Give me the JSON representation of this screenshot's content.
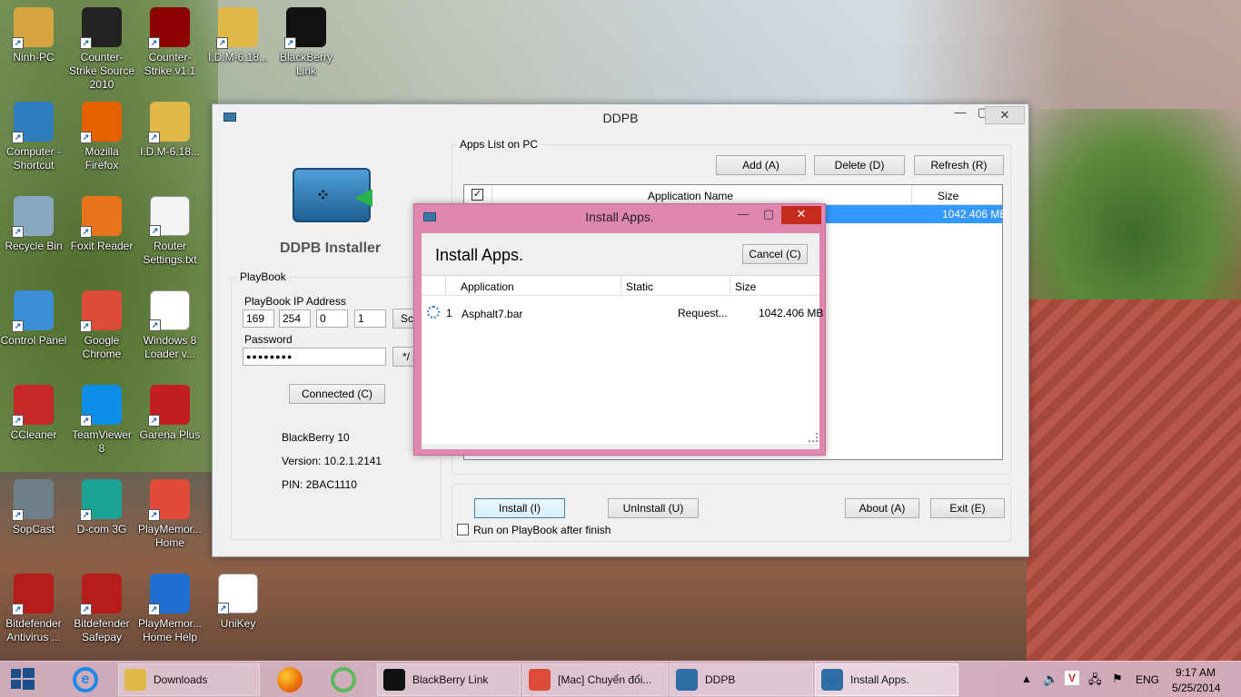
{
  "desktop_icons": [
    {
      "label": "Ninh-PC",
      "icon": "user-folder-icon",
      "color": "#d7a642"
    },
    {
      "label": "Counter-Strike Source 2010",
      "icon": "counter-strike-icon",
      "color": "#222222"
    },
    {
      "label": "Counter-Strike v1.1",
      "icon": "counter-strike-cs-icon",
      "color": "#8b0000"
    },
    {
      "label": "I.D.M-6.18...",
      "icon": "zip-folder-icon",
      "color": "#e2b84a"
    },
    {
      "label": "BlackBerry Link",
      "icon": "blackberry-icon",
      "color": "#111111"
    },
    {
      "label": "Computer - Shortcut",
      "icon": "computer-icon",
      "color": "#2f7cc2"
    },
    {
      "label": "Mozilla Firefox",
      "icon": "firefox-icon",
      "color": "#e66000"
    },
    {
      "label": "I.D.M-6.18...",
      "icon": "zip-folder-icon",
      "color": "#e2b84a"
    },
    {
      "label": "Recycle Bin",
      "icon": "recycle-bin-icon",
      "color": "#8aa7c0"
    },
    {
      "label": "Foxit Reader",
      "icon": "foxit-pdf-icon",
      "color": "#e8741e"
    },
    {
      "label": "Router Settings.txt",
      "icon": "text-file-icon",
      "color": "#f4f4f4"
    },
    {
      "label": "Control Panel",
      "icon": "control-panel-icon",
      "color": "#3b8fd6"
    },
    {
      "label": "Google Chrome",
      "icon": "chrome-icon",
      "color": "#dd4b39"
    },
    {
      "label": "Windows 8 Loader v...",
      "icon": "file-icon",
      "color": "#ffffff"
    },
    {
      "label": "CCleaner",
      "icon": "ccleaner-icon",
      "color": "#c62828"
    },
    {
      "label": "TeamViewer 8",
      "icon": "teamviewer-icon",
      "color": "#0e8ee9"
    },
    {
      "label": "Garena Plus",
      "icon": "garena-icon",
      "color": "#c21f1f"
    },
    {
      "label": "SopCast",
      "icon": "sopcast-icon",
      "color": "#6f7f8a"
    },
    {
      "label": "D-com 3G",
      "icon": "viettel-icon",
      "color": "#1aa392"
    },
    {
      "label": "PlayMemor... Home",
      "icon": "playmemories-icon",
      "color": "#e24a3a"
    },
    {
      "label": "Bitdefender Antivirus ...",
      "icon": "bitdefender-icon",
      "color": "#b71c1c"
    },
    {
      "label": "Bitdefender Safepay",
      "icon": "bitdefender-safepay-icon",
      "color": "#b71c1c"
    },
    {
      "label": "PlayMemor... Home Help",
      "icon": "help-icon",
      "color": "#1f6fd1"
    },
    {
      "label": "UniKey",
      "icon": "unikey-icon",
      "color": "#ffffff"
    }
  ],
  "ddpb": {
    "title": "DDPB",
    "installer_title": "DDPB Installer",
    "playbook_group": "PlayBook",
    "ip_label": "PlayBook IP Address",
    "ip": [
      "169",
      "254",
      "0",
      "1"
    ],
    "scan_label": "Sca",
    "password_label": "Password",
    "password_value": "●●●●●●●●",
    "connected_label": "Connected (C)",
    "device_name": "BlackBerry 10",
    "version": "Version: 10.2.1.2141",
    "pin": "PIN: 2BAC1110",
    "apps_group": "Apps List on PC",
    "add_label": "Add (A)",
    "delete_label": "Delete (D)",
    "refresh_label": "Refresh (R)",
    "col_app_name": "Application Name",
    "col_size": "Size",
    "row_size": "1042.406 MB",
    "install_label": "Install (I)",
    "uninstall_label": "UnInstall (U)",
    "about_label": "About (A)",
    "exit_label": "Exit (E)",
    "run_after_label": "Run on PlayBook after finish"
  },
  "install_dialog": {
    "title": "Install Apps.",
    "heading": "Install Apps.",
    "cancel_label": "Cancel (C)",
    "col_application": "Application",
    "col_static": "Static",
    "col_size": "Size",
    "rows": [
      {
        "index": "1",
        "application": "Asphalt7.bar",
        "static": "Request...",
        "size": "1042.406 MB"
      }
    ]
  },
  "taskbar": {
    "items": [
      {
        "label": "Downloads",
        "icon": "folder-icon",
        "color": "#e2b84a"
      },
      {
        "label": "BlackBerry Link",
        "icon": "blackberry-icon",
        "color": "#111111"
      },
      {
        "label": "[Mac] Chuyển đổi...",
        "icon": "chrome-icon",
        "color": "#dd4b39"
      },
      {
        "label": "DDPB",
        "icon": "ddpb-icon",
        "color": "#2f6ea5"
      },
      {
        "label": "Install Apps.",
        "icon": "ddpb-icon",
        "color": "#2f6ea5"
      }
    ],
    "lang": "ENG",
    "time": "9:17 AM",
    "date": "5/25/2014"
  }
}
